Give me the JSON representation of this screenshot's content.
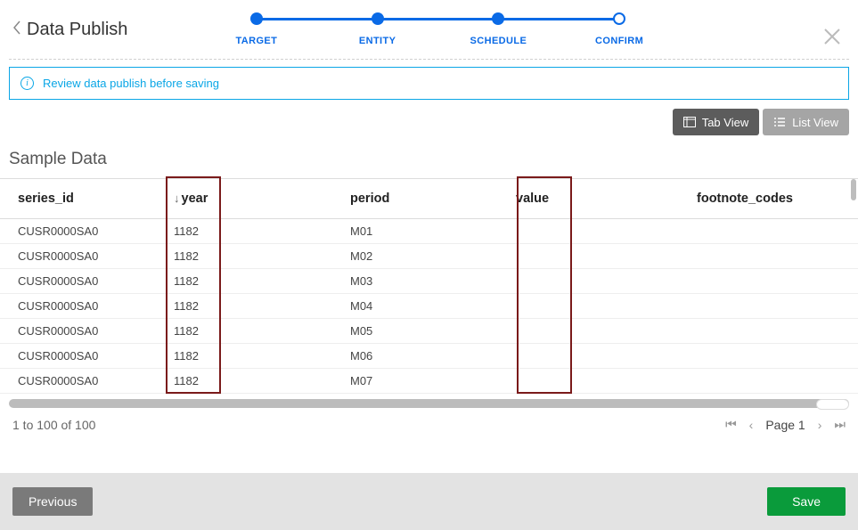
{
  "header": {
    "title": "Data Publish"
  },
  "stepper": {
    "steps": [
      {
        "label": "TARGET",
        "state": "filled"
      },
      {
        "label": "ENTITY",
        "state": "filled"
      },
      {
        "label": "SCHEDULE",
        "state": "filled"
      },
      {
        "label": "CONFIRM",
        "state": "open"
      }
    ]
  },
  "notice": {
    "text": "Review data publish before saving"
  },
  "view_toggle": {
    "tab": "Tab View",
    "list": "List View"
  },
  "section": {
    "title": "Sample Data"
  },
  "table": {
    "columns": {
      "series_id": "series_id",
      "year": "year",
      "period": "period",
      "value": "value",
      "footnote_codes": "footnote_codes"
    },
    "sort_column": "year",
    "rows": [
      {
        "series_id": "CUSR0000SA0",
        "year": "1182",
        "period": "M01",
        "value": "",
        "footnote_codes": ""
      },
      {
        "series_id": "CUSR0000SA0",
        "year": "1182",
        "period": "M02",
        "value": "",
        "footnote_codes": ""
      },
      {
        "series_id": "CUSR0000SA0",
        "year": "1182",
        "period": "M03",
        "value": "",
        "footnote_codes": ""
      },
      {
        "series_id": "CUSR0000SA0",
        "year": "1182",
        "period": "M04",
        "value": "",
        "footnote_codes": ""
      },
      {
        "series_id": "CUSR0000SA0",
        "year": "1182",
        "period": "M05",
        "value": "",
        "footnote_codes": ""
      },
      {
        "series_id": "CUSR0000SA0",
        "year": "1182",
        "period": "M06",
        "value": "",
        "footnote_codes": ""
      },
      {
        "series_id": "CUSR0000SA0",
        "year": "1182",
        "period": "M07",
        "value": "",
        "footnote_codes": ""
      }
    ]
  },
  "pager": {
    "summary": "1 to 100 of 100",
    "page_label": "Page 1"
  },
  "buttons": {
    "previous": "Previous",
    "save": "Save"
  },
  "highlights": [
    "year",
    "value"
  ]
}
